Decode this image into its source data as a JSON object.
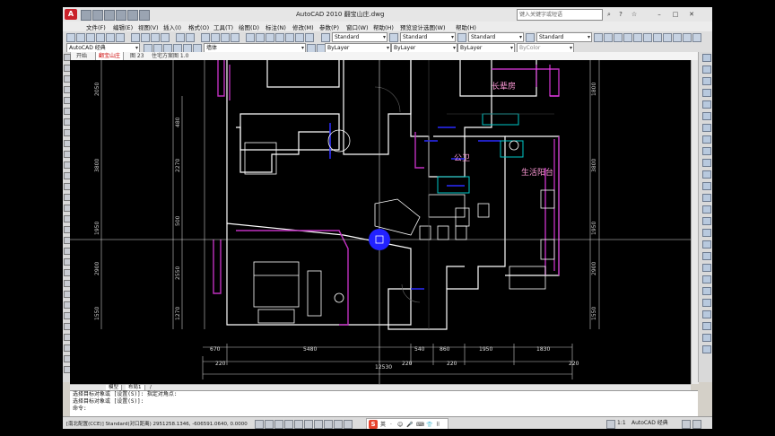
{
  "window": {
    "title": "AutoCAD 2010   翻宝山庄.dwg",
    "search_placeholder": "键入关键字或短语",
    "controls": [
      "?",
      "–",
      "□",
      "✕"
    ]
  },
  "menubar": {
    "items": [
      "文件(F)",
      "编辑(E)",
      "视图(V)",
      "插入(I)",
      "格式(O)",
      "工具(T)",
      "绘图(D)",
      "标注(N)",
      "修改(M)",
      "参数(P)",
      "窗口(W)",
      "帮助(H)",
      "预览设计选图(W)",
      "帮助(H)"
    ]
  },
  "toolbar": {
    "workspace": "AutoCAD 经典",
    "layer": "墙体",
    "text_style": "Standard",
    "dim_style": "Standard",
    "table_style": "Standard",
    "multileader_style": "Standard",
    "color": "ByLayer",
    "linetype": "ByLayer",
    "lineweight": "ByLayer",
    "plot_style": "ByColor"
  },
  "file_tabs": [
    {
      "label": "开始",
      "active": false
    },
    {
      "label": "翻宝山庄",
      "active": true
    },
    {
      "label": "图 23",
      "active": false
    },
    {
      "label": "住宅方案图 1.0",
      "active": false
    }
  ],
  "drawing": {
    "rooms": [
      "长辈房",
      "公卫",
      "生活阳台"
    ],
    "bottom_dims_row1": [
      "670",
      "5480",
      "540",
      "860",
      "1950",
      "1830"
    ],
    "bottom_dims_row2": [
      "220",
      "220",
      "220",
      "220"
    ],
    "total_dim": "12530",
    "left_dims": [
      "2050",
      "3800",
      "1950",
      "2900",
      "1550"
    ],
    "left_inner_dims": [
      "480",
      "2270",
      "500",
      "2550",
      "1270"
    ],
    "right_dims": [
      "1800",
      "3800",
      "1950",
      "2900",
      "1550"
    ],
    "colors": {
      "wall": "#ffffff",
      "purple": "#c030c0",
      "blue": "#2a2aff",
      "magenta": "#ff40ff",
      "cyan": "#00c8c8",
      "dim": "#c8c8c8",
      "crosshair": "#ffffff"
    }
  },
  "layout_tabs": [
    "模型",
    "布局1",
    "/"
  ],
  "command_lines": [
    "选择目标对象或 [设置(S)]: 指定对角点:",
    "选择目标对象或 [设置(S)]:",
    "命令:"
  ],
  "statusbar": {
    "coordinates": "[南北配置(CCE)] Standard(对口距离)   2951258.1346, -606591.0640, 0.0000",
    "workspace": "AutoCAD 经典",
    "scale": "1:1",
    "ime_icons": [
      "英",
      "·",
      "☺",
      "🎤",
      "⌨",
      "👕",
      "⠿"
    ]
  }
}
